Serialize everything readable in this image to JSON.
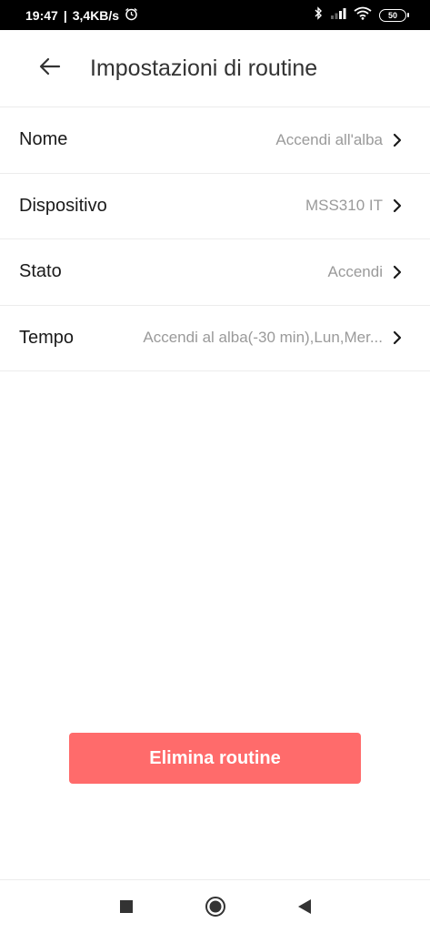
{
  "status_bar": {
    "time": "19:47",
    "network_speed": "3,4KB/s",
    "battery": "50",
    "icons": [
      "alarm-icon",
      "bluetooth-icon",
      "signal-icon",
      "wifi-icon",
      "battery-icon"
    ]
  },
  "header": {
    "title": "Impostazioni di routine",
    "back_icon": "arrow-left-icon"
  },
  "settings": {
    "rows": [
      {
        "label": "Nome",
        "value": "Accendi all'alba"
      },
      {
        "label": "Dispositivo",
        "value": "MSS310 IT"
      },
      {
        "label": "Stato",
        "value": "Accendi"
      },
      {
        "label": "Tempo",
        "value": "Accendi al alba(-30 min),Lun,Mer..."
      }
    ]
  },
  "actions": {
    "delete_label": "Elimina routine"
  },
  "nav": {
    "icons": [
      "square-icon",
      "circle-icon",
      "triangle-back-icon"
    ]
  },
  "colors": {
    "accent": "#ff6b6b",
    "status_bar": "#000000",
    "title": "#333333",
    "value_text": "#9a9a9a",
    "divider": "#ececec"
  }
}
